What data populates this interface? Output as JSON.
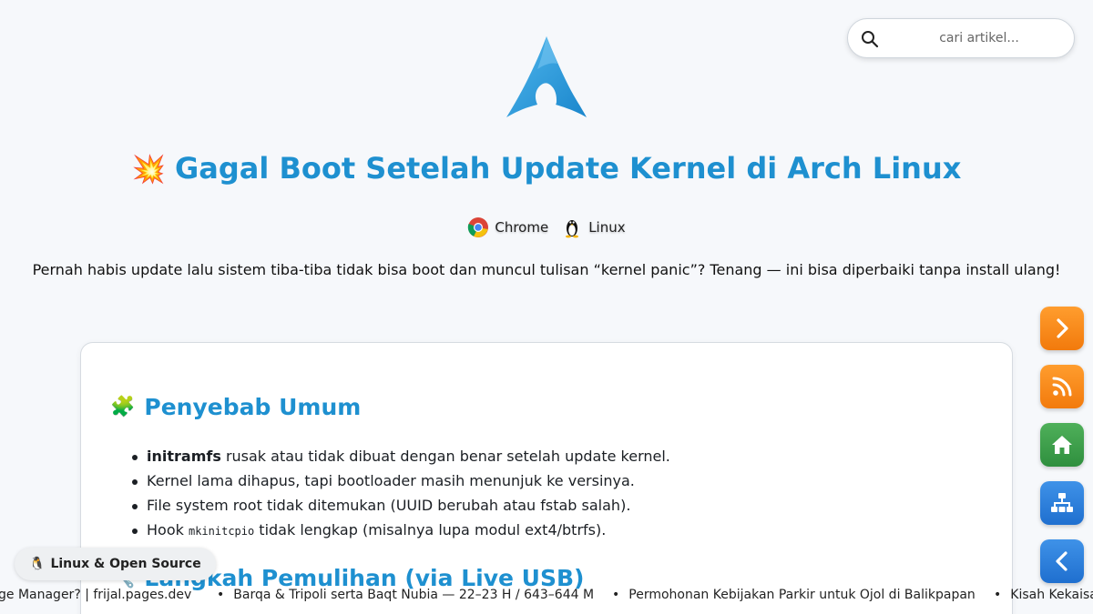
{
  "search": {
    "placeholder": "cari artikel..."
  },
  "header": {
    "title_emoji": "💥",
    "title": "Gagal Boot Setelah Update Kernel di Arch Linux",
    "tags": [
      {
        "icon": "chrome-icon",
        "label": "Chrome"
      },
      {
        "icon": "tux-icon",
        "label": "Linux"
      }
    ],
    "intro": "Pernah habis update lalu sistem tiba-tiba tidak bisa boot dan muncul tulisan “kernel panic”? Tenang — ini bisa diperbaiki tanpa install ulang!"
  },
  "article": {
    "section1": {
      "emoji": "🧩",
      "heading": "Penyebab Umum",
      "items": [
        {
          "strong": "initramfs",
          "text": " rusak atau tidak dibuat dengan benar setelah update kernel."
        },
        {
          "text": "Kernel lama dihapus, tapi bootloader masih menunjuk ke versinya."
        },
        {
          "text": "File system root tidak ditemukan (UUID berubah atau fstab salah)."
        },
        {
          "prefix": "Hook ",
          "code": "mkinitcpio",
          "text": " tidak lengkap (misalnya lupa modul ext4/btrfs)."
        }
      ]
    },
    "section2": {
      "emoji": "🔧",
      "heading": "Langkah Pemulihan (via Live USB)"
    }
  },
  "side_buttons": [
    {
      "icon": "chevron-right-icon",
      "color": "#f58a1a"
    },
    {
      "icon": "rss-icon",
      "color": "#f58a1a"
    },
    {
      "icon": "home-icon",
      "color": "#3a9d48"
    },
    {
      "icon": "sitemap-icon",
      "color": "#2a7fdc"
    },
    {
      "icon": "chevron-left-icon",
      "color": "#2a7fdc"
    }
  ],
  "badge": {
    "emoji": "🐧",
    "label": "Linux & Open Source"
  },
  "ticker": [
    "ge Manager? | frijal.pages.dev",
    "Barqa & Tripoli serta Baqt Nubia — 22–23 H / 643–644 M",
    "Permohonan Kebijakan Parkir untuk Ojol di Balikpapan",
    "Kisah Kekaisar"
  ]
}
